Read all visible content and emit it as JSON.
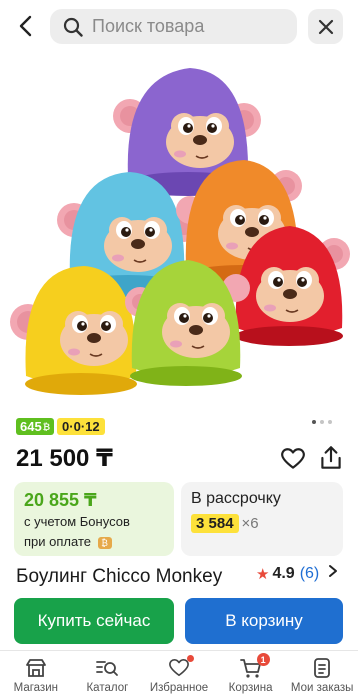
{
  "search": {
    "placeholder": "Поиск товара"
  },
  "badges": {
    "green": "645",
    "yellow": "0·0·12"
  },
  "gallery": {
    "dots_total": 3,
    "active_index": 0
  },
  "price": {
    "current": "21 500 ₸"
  },
  "bonus": {
    "price": "20 855 ₸",
    "line1": "с учетом Бонусов",
    "line2": "при оплате"
  },
  "installment": {
    "title": "В рассрочку",
    "amount": "3 584",
    "multiplier": "×6"
  },
  "product": {
    "title": "Боулинг Chicco Monkey"
  },
  "rating": {
    "score": "4.9",
    "count": "(6)"
  },
  "actions": {
    "buy_now": "Купить сейчас",
    "add_to_cart": "В корзину"
  },
  "bottom_nav": {
    "items": [
      {
        "label": "Магазин",
        "icon": "shop-icon"
      },
      {
        "label": "Каталог",
        "icon": "catalog-search-icon"
      },
      {
        "label": "Избранное",
        "icon": "heart-icon"
      },
      {
        "label": "Корзина",
        "icon": "cart-icon",
        "badge": "1"
      },
      {
        "label": "Мои заказы",
        "icon": "orders-icon"
      }
    ]
  },
  "colors": {
    "green_accent": "#18a24a",
    "blue_accent": "#1f6fd0",
    "bonus_green": "#4aa61b",
    "yellow_badge": "#fde13a",
    "star_red": "#e84a3a"
  }
}
